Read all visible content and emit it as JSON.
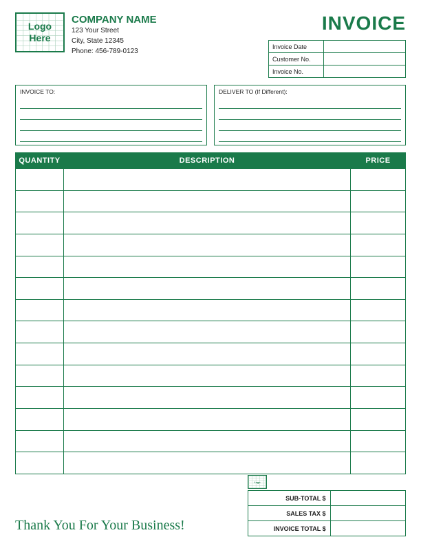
{
  "header": {
    "logo_text_line1": "Logo",
    "logo_text_line2": "Here",
    "company_name": "COMPANY NAME",
    "address_line1": "123 Your Street",
    "address_line2": "City, State 12345",
    "phone": "Phone: 456-789-0123",
    "invoice_title": "INVOICE",
    "fields": [
      {
        "label": "Invoice Date",
        "value": ""
      },
      {
        "label": "Customer No.",
        "value": ""
      },
      {
        "label": "Invoice No.",
        "value": ""
      }
    ]
  },
  "address": {
    "invoice_to_label": "INVOICE TO:",
    "deliver_to_label": "DELIVER TO (If Different):"
  },
  "table": {
    "col_quantity": "QUANTITY",
    "col_description": "DESCRIPTION",
    "col_price": "PRICE",
    "rows": 14
  },
  "totals": {
    "sub_total_label": "SUB-TOTAL $",
    "sales_tax_label": "SALES TAX $",
    "invoice_total_label": "INVOICE TOTAL $",
    "sub_total_value": "",
    "sales_tax_value": "",
    "invoice_total_value": ""
  },
  "footer": {
    "thank_you": "Thank You For Your Business!"
  }
}
